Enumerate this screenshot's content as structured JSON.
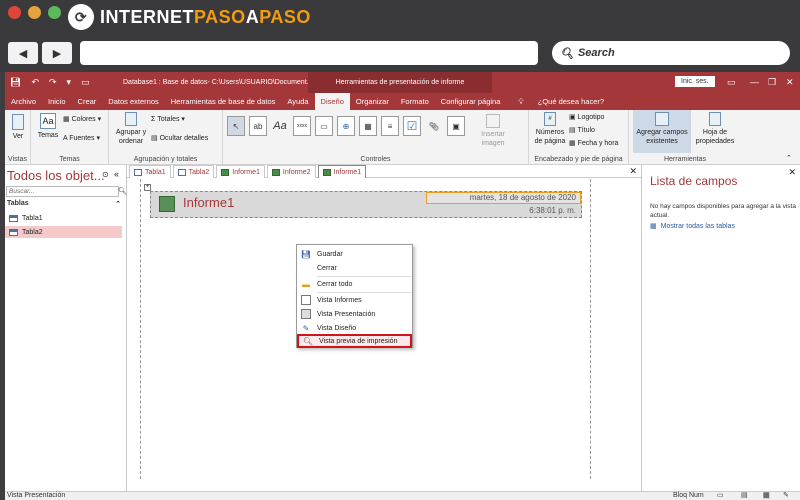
{
  "browser": {
    "brand_a": "INTERNET",
    "brand_b": "PASO",
    "brand_c": "A",
    "brand_d": "PASO",
    "back_icon": "left-arrow-icon",
    "forward_icon": "right-arrow-icon",
    "search_label": "Search"
  },
  "app": {
    "db_title": "Database1 : Base de datos- C:\\Users\\USUARIO\\Document...",
    "context_tools": "Herramientas de presentación de informe",
    "sign_in": "Inic. ses."
  },
  "menu": [
    "Archivo",
    "Inicio",
    "Crear",
    "Datos externos",
    "Herramientas de base de datos",
    "Ayuda",
    "Diseño",
    "Organizar",
    "Formato",
    "Configurar página"
  ],
  "tell_me": "¿Qué desea hacer?",
  "ribbon": {
    "ver": "Ver",
    "vistas": "Vistas",
    "temas_btn": "Temas",
    "colores": "Colores",
    "fuentes": "Fuentes",
    "temas": "Temas",
    "agrupar": "Agrupar y ordenar",
    "totales": "Totales",
    "ocultar": "Ocultar detalles",
    "agrupacion": "Agrupación y totales",
    "insertar_imagen": "Insertar imagen",
    "controles": "Controles",
    "numeros": "Números de página",
    "logotipo": "Logotipo",
    "titulo": "Título",
    "fecha": "Fecha y hora",
    "encabezado": "Encabezado y pie de página",
    "agregar_campos": "Agregar campos existentes",
    "hoja_prop": "Hoja de propiedades",
    "herramientas": "Herramientas"
  },
  "nav": {
    "title": "Todos los objet...",
    "search_placeholder": "Buscar...",
    "section": "Tablas",
    "items": [
      "Tabla1",
      "Tabla2"
    ]
  },
  "tabs": [
    "Tabla1",
    "Tabla2",
    "Informe1",
    "Informe2",
    "Informe1"
  ],
  "report": {
    "title": "Informe1",
    "date": "martes, 18 de agosto de 2020",
    "time": "6:38:01 p. m."
  },
  "context_menu": {
    "guardar": "Guardar",
    "cerrar": "Cerrar",
    "cerrar_todo": "Cerrar todo",
    "vista_informes": "Vista Informes",
    "vista_presentacion": "Vista Presentación",
    "vista_diseno": "Vista Diseño",
    "vista_previa": "Vista previa de impresión"
  },
  "field_list": {
    "title": "Lista de campos",
    "message": "No hay campos disponibles para agregar a la vista actual.",
    "link": "Mostrar todas las tablas"
  },
  "status": {
    "left": "Vista Presentación",
    "right": "Bloq Num"
  }
}
